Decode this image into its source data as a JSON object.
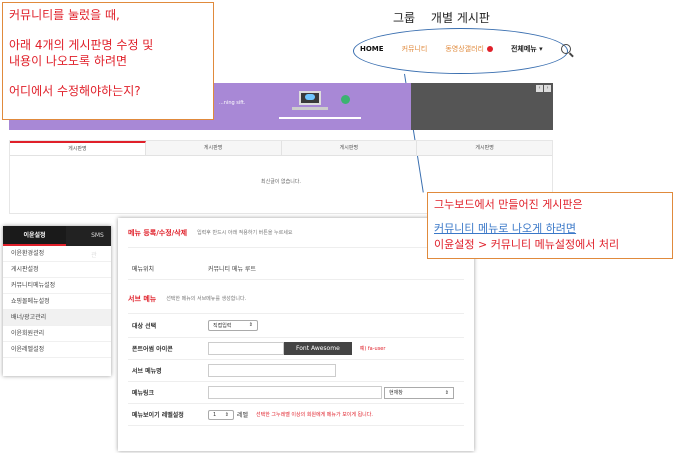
{
  "notes": {
    "left": {
      "line1": "커뮤니티를 눌렀을 때,",
      "line2": "아래 4개의 게시판명 수정 및",
      "line3": "내용이 나오도록 하려면",
      "line4": "어디에서 수정해야하는지?"
    },
    "right": {
      "line1": "그누보드에서 만들어진 게시판은",
      "line2": "커뮤니티 메뉴로 나오게 하려면",
      "line3": "이윤설정 >  커뮤니티 메뉴설정에서 처리"
    },
    "top_labels": [
      "그룹",
      "개별 게시판"
    ]
  },
  "nav": {
    "home": "HOME",
    "community": "커뮤니티",
    "gallery": "동영상갤러리",
    "all_menu": "전체메뉴",
    "all_menu_caret": "▾"
  },
  "banner": {
    "slogan": "...ning sift.",
    "prev": "‹",
    "next": "›"
  },
  "board": {
    "tabs": [
      "게시판명",
      "게시판명",
      "게시판명",
      "게시판명"
    ],
    "empty_text": "최신글이 없습니다."
  },
  "sidebar": {
    "active_tab": "이윤설정",
    "other_tab": "SMS 관",
    "items": [
      "이윤환경설정",
      "게시판설정",
      "커뮤니티메뉴설정",
      "쇼핑몰메뉴설정",
      "배너/광고관리",
      "이윤회원관리",
      "이윤레벨설정"
    ]
  },
  "panel": {
    "section1": {
      "title": "메뉴 등록/수정/삭제",
      "desc": "입력후 반드시 아래 적용하기 버튼을 누르세요"
    },
    "menu_position": {
      "label": "메뉴위치",
      "value": "커뮤니티 메뉴 루트"
    },
    "section2": {
      "title": "서브 메뉴",
      "desc": "선택한 메뉴의 서브메뉴를 생성합니다."
    },
    "target_select": {
      "label": "대상 선택",
      "value": "직접입력"
    },
    "font_icon": {
      "label": "폰트어썸 아이콘",
      "button": "Font Awesome",
      "hint": "예) fa-user"
    },
    "sub_menu_name": {
      "label": "서브 메뉴명"
    },
    "menu_link": {
      "label": "메뉴링크",
      "window_value": "현재창"
    },
    "level_setting": {
      "label": "메뉴보이기 레벨설정",
      "value": "1",
      "unit": "레벨",
      "hint": "선택한 그누레벨 이상의 회원에게 메뉴가 보이게 됩니다."
    }
  },
  "colors": {
    "accent_red": "#e0202a",
    "note_border": "#e08a3c",
    "annotation_blue": "#3a6fb0",
    "banner_purple": "#a888d6"
  }
}
